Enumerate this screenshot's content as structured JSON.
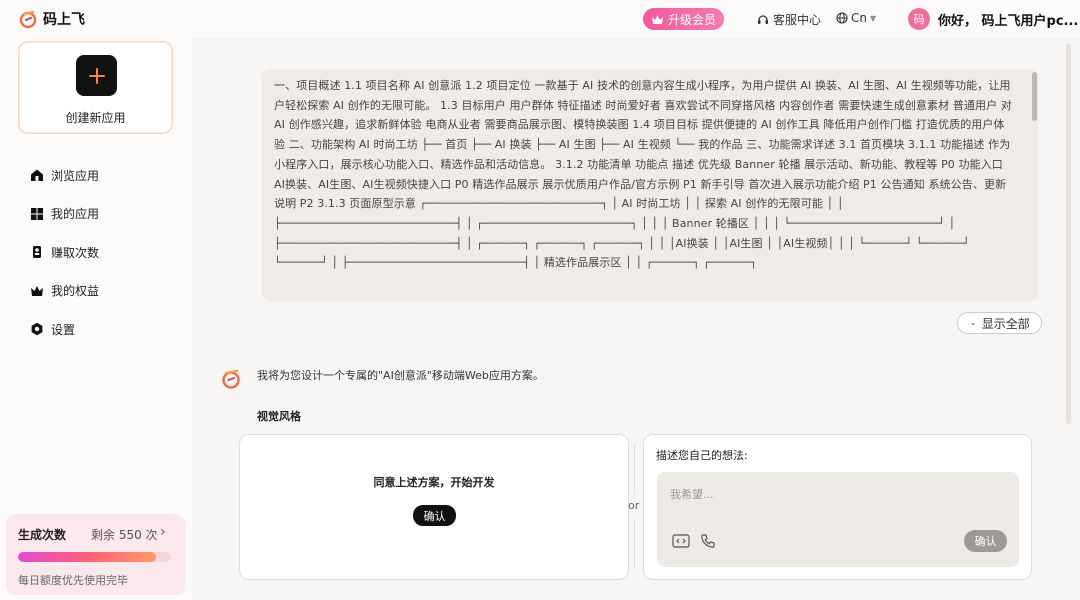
{
  "header": {
    "brand": "码上飞",
    "upgrade_label": "升级会员",
    "support_label": "客服中心",
    "lang_label": "Cn",
    "avatar_text": "码",
    "user_greeting": "你好， 码上飞用户pc..."
  },
  "sidebar": {
    "create_label": "创建新应用",
    "items": [
      {
        "label": "浏览应用",
        "icon": "home-icon"
      },
      {
        "label": "我的应用",
        "icon": "grid-icon"
      },
      {
        "label": "赚取次数",
        "icon": "badge-icon"
      },
      {
        "label": "我的权益",
        "icon": "crown-icon"
      },
      {
        "label": "设置",
        "icon": "gear-icon"
      }
    ],
    "credits": {
      "title": "生成次数",
      "remaining": "剩余 550 次",
      "note": "每日额度优先使用完毕",
      "fill_percent": 90
    }
  },
  "main": {
    "document_text": "一、项目概述 1.1 项目名称 AI 创意派 1.2 项目定位 一款基于 AI 技术的创意内容生成小程序，为用户提供 AI 换装、AI 生图、AI 生视频等功能，让用户轻松探索 AI 创作的无限可能。 1.3 目标用户 用户群体 特征描述 时尚爱好者 喜欢尝试不同穿搭风格 内容创作者 需要快速生成创意素材 普通用户 对 AI 创作感兴趣，追求新鲜体验 电商从业者 需要商品展示图、模特换装图 1.4 项目目标 提供便捷的 AI 创作工具 降低用户创作门槛 打造优质的用户体验 二、功能架构 AI 时尚工坊 ├── 首页 ├── AI 换装 ├── AI 生图 ├── AI 生视频 └── 我的作品 三、功能需求详述 3.1 首页模块 3.1.1 功能描述 作为小程序入口，展示核心功能入口、精选作品和活动信息。 3.1.2 功能清单 功能点 描述 优先级 Banner 轮播 展示活动、新功能、教程等 P0 功能入口 AI换装、AI生图、AI生视频快捷入口 P0 精选作品展示 展示优质用户作品/官方示例 P1 新手引导 首次进入展示功能介绍 P1 公告通知 系统公告、更新说明 P2 3.1.3 页面原型示意 ┌──────────────────────────┐ │ AI 时尚工坊 │ │ 探索 AI 创作的无限可能 │ │ ├──────────────────────────┤ │ ┌──────────────────────┐ │ │ │ Banner 轮播区 │ │ │ └──────────────────────┘ │ ├──────────────────────────┤ │ ┌──────┐ ┌──────┐ ┌──────┐ │ │ │AI换装 │ │AI生图 │ │AI生视频│ │ │ └──────┘ └──────┘ └──────┘ │ ├──────────────────────────┤ │ 精选作品展示区 │ │ ┌──────┐ ┌──────┐",
    "show_all_label": "显示全部",
    "assistant_message": "我将为您设计一个专属的\"AI创意派\"移动端Web应用方案。",
    "visual_style_label": "视觉风格",
    "option_left": {
      "title": "同意上述方案，开始开发",
      "confirm_label": "确认"
    },
    "or_label": "or",
    "option_right": {
      "title": "描述您自己的想法:",
      "placeholder": "我希望...",
      "confirm_label": "确认"
    }
  }
}
